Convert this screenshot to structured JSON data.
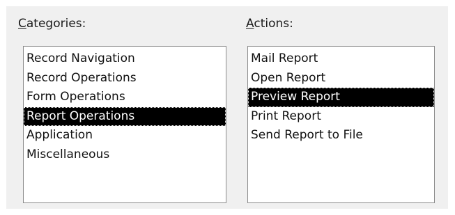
{
  "categories": {
    "label_accel": "C",
    "label_rest": "ategories:",
    "items": [
      {
        "label": "Record Navigation",
        "selected": false
      },
      {
        "label": "Record Operations",
        "selected": false
      },
      {
        "label": "Form Operations",
        "selected": false
      },
      {
        "label": "Report Operations",
        "selected": true
      },
      {
        "label": "Application",
        "selected": false
      },
      {
        "label": "Miscellaneous",
        "selected": false
      }
    ]
  },
  "actions": {
    "label_accel": "A",
    "label_rest": "ctions:",
    "items": [
      {
        "label": "Mail Report",
        "selected": false
      },
      {
        "label": "Open Report",
        "selected": false
      },
      {
        "label": "Preview Report",
        "selected": true
      },
      {
        "label": "Print Report",
        "selected": false
      },
      {
        "label": "Send Report to File",
        "selected": false
      }
    ]
  },
  "colors": {
    "panel_background": "#f0f0f0",
    "selection_background": "#000000",
    "selection_text": "#ffffff",
    "listbox_border": "#8a8a8a"
  }
}
